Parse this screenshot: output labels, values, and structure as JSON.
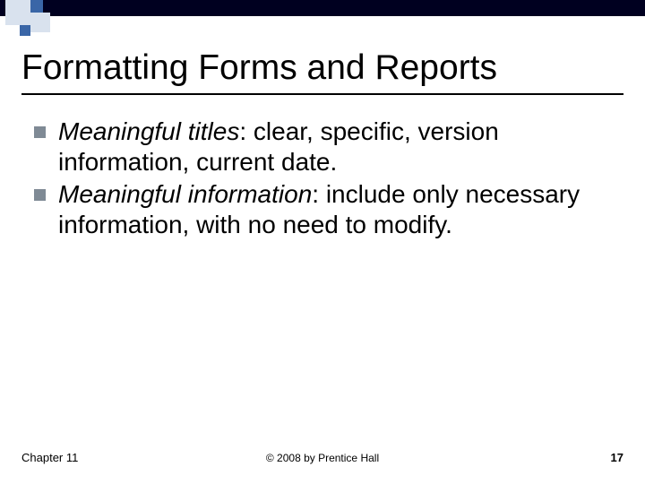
{
  "title": "Formatting Forms and Reports",
  "bullets": [
    {
      "lead": "Meaningful titles",
      "rest": ": clear, specific, version information, current date."
    },
    {
      "lead": "Meaningful information",
      "rest": ": include only necessary information, with no need to modify."
    }
  ],
  "footer": {
    "left": "Chapter 11",
    "center": "© 2008 by Prentice Hall",
    "right": "17"
  }
}
